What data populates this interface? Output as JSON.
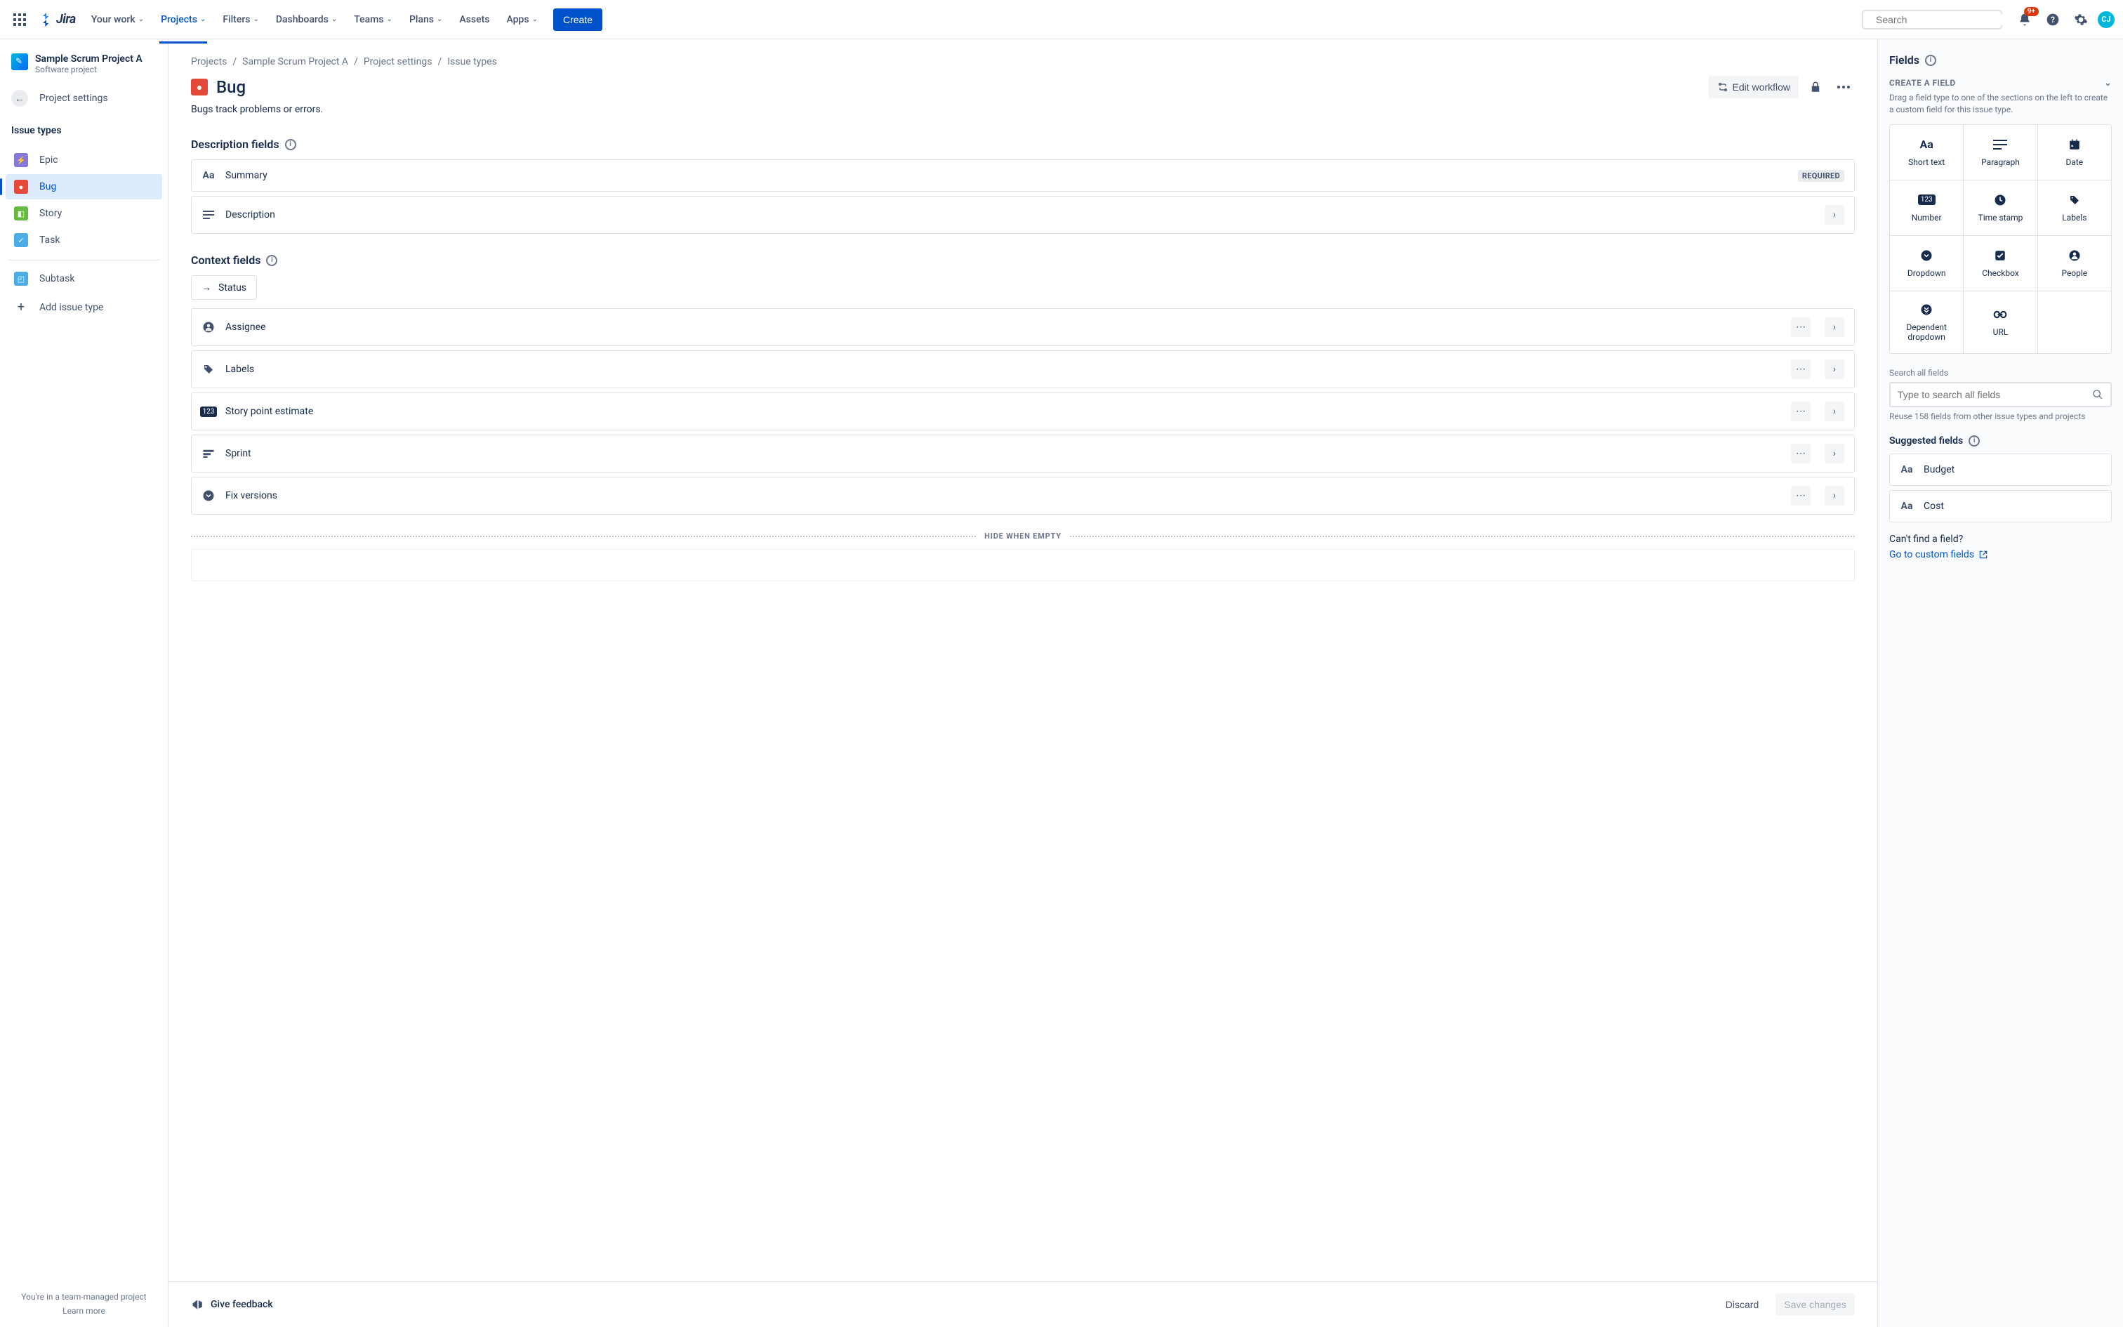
{
  "topbar": {
    "logo_text": "Jira",
    "nav": [
      {
        "label": "Your work",
        "active": false
      },
      {
        "label": "Projects",
        "active": true
      },
      {
        "label": "Filters",
        "active": false
      },
      {
        "label": "Dashboards",
        "active": false
      },
      {
        "label": "Teams",
        "active": false
      },
      {
        "label": "Plans",
        "active": false
      },
      {
        "label": "Assets",
        "active": false,
        "no_chevron": true
      },
      {
        "label": "Apps",
        "active": false
      }
    ],
    "create": "Create",
    "search_placeholder": "Search",
    "notification_badge": "9+",
    "avatar_initials": "CJ"
  },
  "sidebar": {
    "project_name": "Sample Scrum Project A",
    "project_type": "Software project",
    "back_label": "Project settings",
    "section_heading": "Issue types",
    "issue_types": [
      {
        "label": "Epic",
        "cls": "it-epic",
        "glyph": "⚡"
      },
      {
        "label": "Bug",
        "cls": "it-bug",
        "glyph": "●",
        "active": true
      },
      {
        "label": "Story",
        "cls": "it-story",
        "glyph": "◧"
      },
      {
        "label": "Task",
        "cls": "it-task",
        "glyph": "✓"
      }
    ],
    "subtask": {
      "label": "Subtask",
      "cls": "it-subtask",
      "glyph": "◰"
    },
    "add_label": "Add issue type",
    "footer_text": "You're in a team-managed project",
    "learn_more": "Learn more"
  },
  "main": {
    "breadcrumbs": [
      "Projects",
      "Sample Scrum Project A",
      "Project settings",
      "Issue types"
    ],
    "title": "Bug",
    "edit_workflow": "Edit workflow",
    "description": "Bugs track problems or errors.",
    "desc_section": "Description fields",
    "context_section": "Context fields",
    "fields_desc": [
      {
        "name": "Summary",
        "required": true,
        "icon": "Aa"
      },
      {
        "name": "Description",
        "icon": "≡",
        "expandable": true
      }
    ],
    "status_label": "Status",
    "fields_context": [
      {
        "name": "Assignee",
        "icon": "person"
      },
      {
        "name": "Labels",
        "icon": "tag"
      },
      {
        "name": "Story point estimate",
        "icon": "123"
      },
      {
        "name": "Sprint",
        "icon": "sprint"
      },
      {
        "name": "Fix versions",
        "icon": "dropdown"
      }
    ],
    "hide_label": "HIDE WHEN EMPTY",
    "required_label": "REQUIRED"
  },
  "footer": {
    "feedback": "Give feedback",
    "discard": "Discard",
    "save": "Save changes"
  },
  "right": {
    "title": "Fields",
    "create_heading": "CREATE A FIELD",
    "create_help": "Drag a field type to one of the sections on the left to create a custom field for this issue type.",
    "types": [
      {
        "label": "Short text",
        "icon": "Aa"
      },
      {
        "label": "Paragraph",
        "icon": "≡"
      },
      {
        "label": "Date",
        "icon": "📅"
      },
      {
        "label": "Number",
        "icon": "123"
      },
      {
        "label": "Time stamp",
        "icon": "🕐"
      },
      {
        "label": "Labels",
        "icon": "🏷"
      },
      {
        "label": "Dropdown",
        "icon": "⌄"
      },
      {
        "label": "Checkbox",
        "icon": "☑"
      },
      {
        "label": "People",
        "icon": "👤"
      },
      {
        "label": "Dependent dropdown",
        "icon": "⇊"
      },
      {
        "label": "URL",
        "icon": "🔗"
      }
    ],
    "search_label": "Search all fields",
    "search_placeholder": "Type to search all fields",
    "reuse_text": "Reuse 158 fields from other issue types and projects",
    "suggested_heading": "Suggested fields",
    "suggested": [
      {
        "label": "Budget"
      },
      {
        "label": "Cost"
      }
    ],
    "cant_find": "Can't find a field?",
    "custom_link": "Go to custom fields"
  }
}
